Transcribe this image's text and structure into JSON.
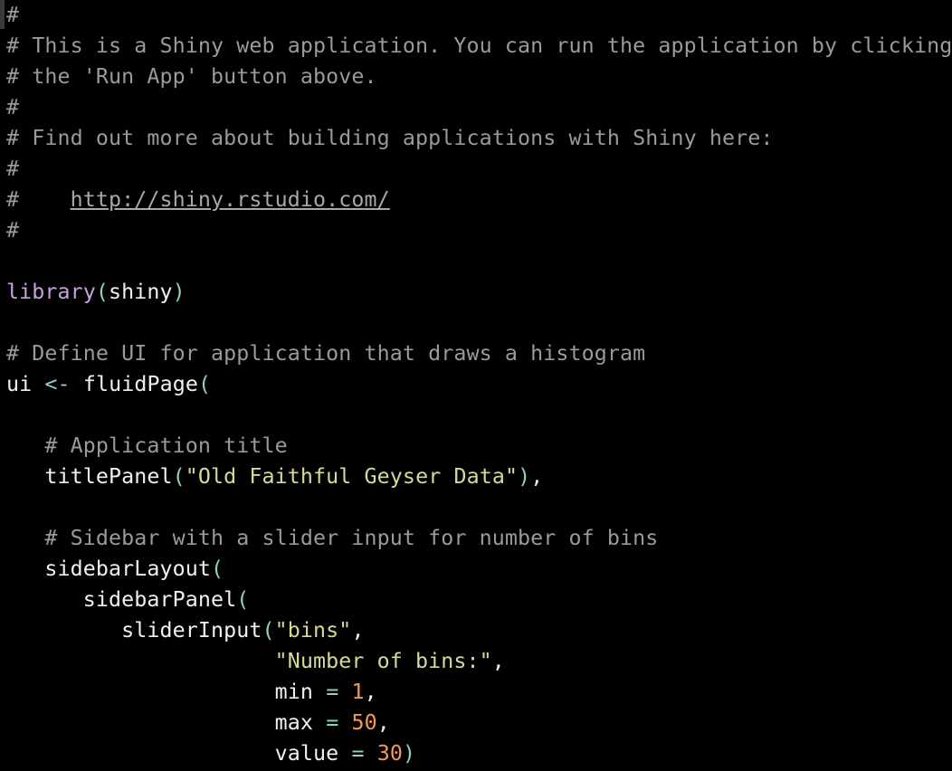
{
  "colors": {
    "background": "#000000",
    "comment": "#9a9a9a",
    "text": "#f0f0f0",
    "keyword": "#c9a0dc",
    "paren": "#8fd0c8",
    "string": "#d8d898",
    "number": "#f29a54"
  },
  "code": {
    "l1": "#",
    "l2": "# This is a Shiny web application. You can run the application by clicking",
    "l3": "# the 'Run App' button above.",
    "l4": "#",
    "l5": "# Find out more about building applications with Shiny here:",
    "l6": "#",
    "l7_prefix": "#    ",
    "l7_link": "http://shiny.rstudio.com/",
    "l8": "#",
    "l10_fn": "library",
    "l10_open": "(",
    "l10_arg": "shiny",
    "l10_close": ")",
    "l12": "# Define UI for application that draws a histogram",
    "l13_id": "ui",
    "l13_op": "<-",
    "l13_fn": "fluidPage",
    "l13_open": "(",
    "l15": "# Application title",
    "l16_fn": "titlePanel",
    "l16_open": "(",
    "l16_str": "\"Old Faithful Geyser Data\"",
    "l16_close": ")",
    "l16_tail": ",",
    "l18": "# Sidebar with a slider input for number of bins",
    "l19_fn": "sidebarLayout",
    "l19_open": "(",
    "l20_fn": "sidebarPanel",
    "l20_open": "(",
    "l21_fn": "sliderInput",
    "l21_open": "(",
    "l21_str": "\"bins\"",
    "l21_tail": ",",
    "l22_str": "\"Number of bins:\"",
    "l22_tail": ",",
    "l23_id": "min",
    "l23_op": "=",
    "l23_num": "1",
    "l23_tail": ",",
    "l24_id": "max",
    "l24_op": "=",
    "l24_num": "50",
    "l24_tail": ",",
    "l25_id": "value",
    "l25_op": "=",
    "l25_num": "30",
    "l25_close": ")"
  }
}
